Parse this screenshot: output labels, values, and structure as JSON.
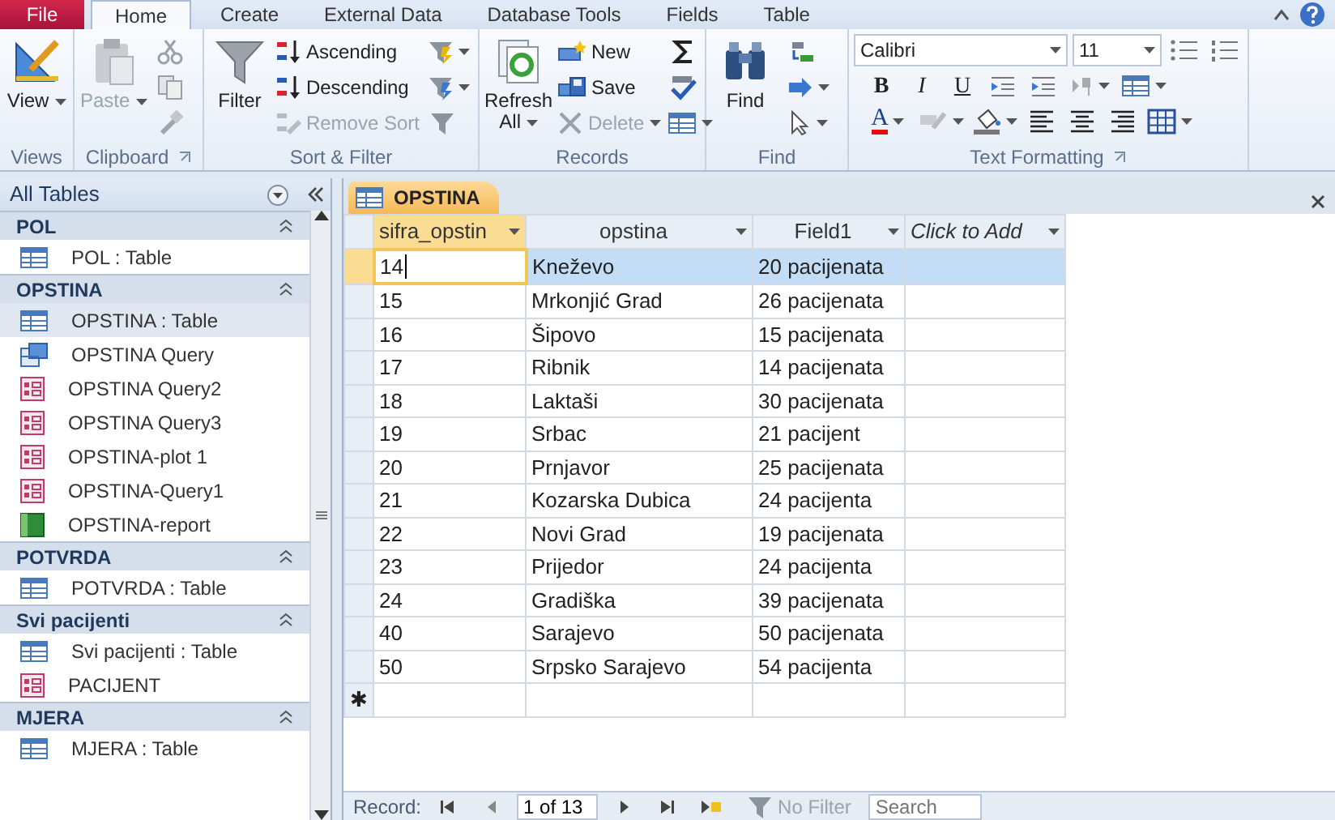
{
  "tabs": [
    {
      "label": "File",
      "kind": "file",
      "selected": false
    },
    {
      "label": "Home",
      "kind": "tab",
      "selected": true
    },
    {
      "label": "Create",
      "kind": "tab",
      "selected": false
    },
    {
      "label": "External Data",
      "kind": "tab",
      "selected": false
    },
    {
      "label": "Database Tools",
      "kind": "tab",
      "selected": false
    },
    {
      "label": "Fields",
      "kind": "tab",
      "selected": false
    },
    {
      "label": "Table",
      "kind": "tab",
      "selected": false
    }
  ],
  "ribbon": {
    "groups": [
      {
        "label": "Views",
        "commands": [
          {
            "label": "View",
            "kind": "large",
            "disabled": false
          }
        ]
      },
      {
        "label": "Clipboard",
        "commands": [
          {
            "label": "Paste",
            "kind": "large",
            "disabled": true
          }
        ]
      },
      {
        "label": "Sort & Filter",
        "commands": [
          {
            "label": "Filter",
            "kind": "large",
            "disabled": false
          },
          {
            "label": "Ascending",
            "kind": "small",
            "disabled": false
          },
          {
            "label": "Descending",
            "kind": "small",
            "disabled": false
          },
          {
            "label": "Remove Sort",
            "kind": "small",
            "disabled": true
          }
        ]
      },
      {
        "label": "Records",
        "commands": [
          {
            "label": "Refresh All",
            "kind": "large",
            "disabled": false
          },
          {
            "label": "New",
            "kind": "small",
            "disabled": false
          },
          {
            "label": "Save",
            "kind": "small",
            "disabled": false
          },
          {
            "label": "Delete",
            "kind": "small",
            "disabled": true
          }
        ]
      },
      {
        "label": "Find",
        "commands": [
          {
            "label": "Find",
            "kind": "large",
            "disabled": false
          }
        ]
      },
      {
        "label": "Text Formatting",
        "font": "Calibri",
        "size": "11",
        "style_buttons": [
          {
            "label": "B",
            "kind": "bold"
          },
          {
            "label": "I",
            "kind": "italic"
          },
          {
            "label": "U",
            "kind": "underline"
          }
        ],
        "font_color_button": "A"
      }
    ]
  },
  "navigation": {
    "title": "All Tables",
    "groups": [
      {
        "label": "POL",
        "items": [
          {
            "label": "POL : Table",
            "kind": "table",
            "selected": false
          }
        ]
      },
      {
        "label": "OPSTINA",
        "items": [
          {
            "label": "OPSTINA : Table",
            "kind": "table",
            "selected": true
          },
          {
            "label": "OPSTINA Query",
            "kind": "query",
            "selected": false
          },
          {
            "label": "OPSTINA Query2",
            "kind": "form",
            "selected": false
          },
          {
            "label": "OPSTINA Query3",
            "kind": "form",
            "selected": false
          },
          {
            "label": "OPSTINA-plot 1",
            "kind": "form",
            "selected": false
          },
          {
            "label": "OPSTINA-Query1",
            "kind": "form",
            "selected": false
          },
          {
            "label": "OPSTINA-report",
            "kind": "report",
            "selected": false
          }
        ]
      },
      {
        "label": "POTVRDA",
        "items": [
          {
            "label": "POTVRDA : Table",
            "kind": "table",
            "selected": false
          }
        ]
      },
      {
        "label": "Svi pacijenti",
        "items": [
          {
            "label": "Svi pacijenti : Table",
            "kind": "table",
            "selected": false
          },
          {
            "label": "PACIJENT",
            "kind": "form",
            "selected": false
          }
        ]
      },
      {
        "label": "MJERA",
        "items": [
          {
            "label": "MJERA : Table",
            "kind": "table",
            "selected": false
          }
        ]
      }
    ]
  },
  "document": {
    "tab": "OPSTINA",
    "columns": [
      {
        "label": "sifra_opstin",
        "kind": "field",
        "selected": true
      },
      {
        "label": "opstina",
        "kind": "field",
        "selected": false
      },
      {
        "label": "Field1",
        "kind": "field",
        "selected": false
      },
      {
        "label": "Click to Add",
        "kind": "add",
        "selected": false
      }
    ],
    "rows": [
      {
        "cells": [
          "14",
          "Kneževo",
          "20 pacijenata",
          ""
        ],
        "selected": true
      },
      {
        "cells": [
          "15",
          "Mrkonjić Grad",
          "26 pacijenata",
          ""
        ],
        "selected": false
      },
      {
        "cells": [
          "16",
          "Šipovo",
          "15 pacijenata",
          ""
        ],
        "selected": false
      },
      {
        "cells": [
          "17",
          "Ribnik",
          "14 pacijenata",
          ""
        ],
        "selected": false
      },
      {
        "cells": [
          "18",
          "Laktaši",
          "30 pacijenata",
          ""
        ],
        "selected": false
      },
      {
        "cells": [
          "19",
          "Srbac",
          "21 pacijent",
          ""
        ],
        "selected": false
      },
      {
        "cells": [
          "20",
          "Prnjavor",
          "25 pacijenata",
          ""
        ],
        "selected": false
      },
      {
        "cells": [
          "21",
          "Kozarska Dubica",
          "24 pacijenta",
          ""
        ],
        "selected": false
      },
      {
        "cells": [
          "22",
          "Novi Grad",
          "19 pacijenata",
          ""
        ],
        "selected": false
      },
      {
        "cells": [
          "23",
          "Prijedor",
          "24 pacijenta",
          ""
        ],
        "selected": false
      },
      {
        "cells": [
          "24",
          "Gradiška",
          "39 pacijenata",
          ""
        ],
        "selected": false
      },
      {
        "cells": [
          "40",
          "Sarajevo",
          "50 pacijenata",
          ""
        ],
        "selected": false
      },
      {
        "cells": [
          "50",
          "Srpsko Sarajevo",
          "54 pacijenta",
          ""
        ],
        "selected": false
      }
    ],
    "new_row_marker": "✱"
  },
  "record_bar": {
    "label": "Record:",
    "position": "1 of 13",
    "filter": "No Filter",
    "search_placeholder": "Search"
  }
}
